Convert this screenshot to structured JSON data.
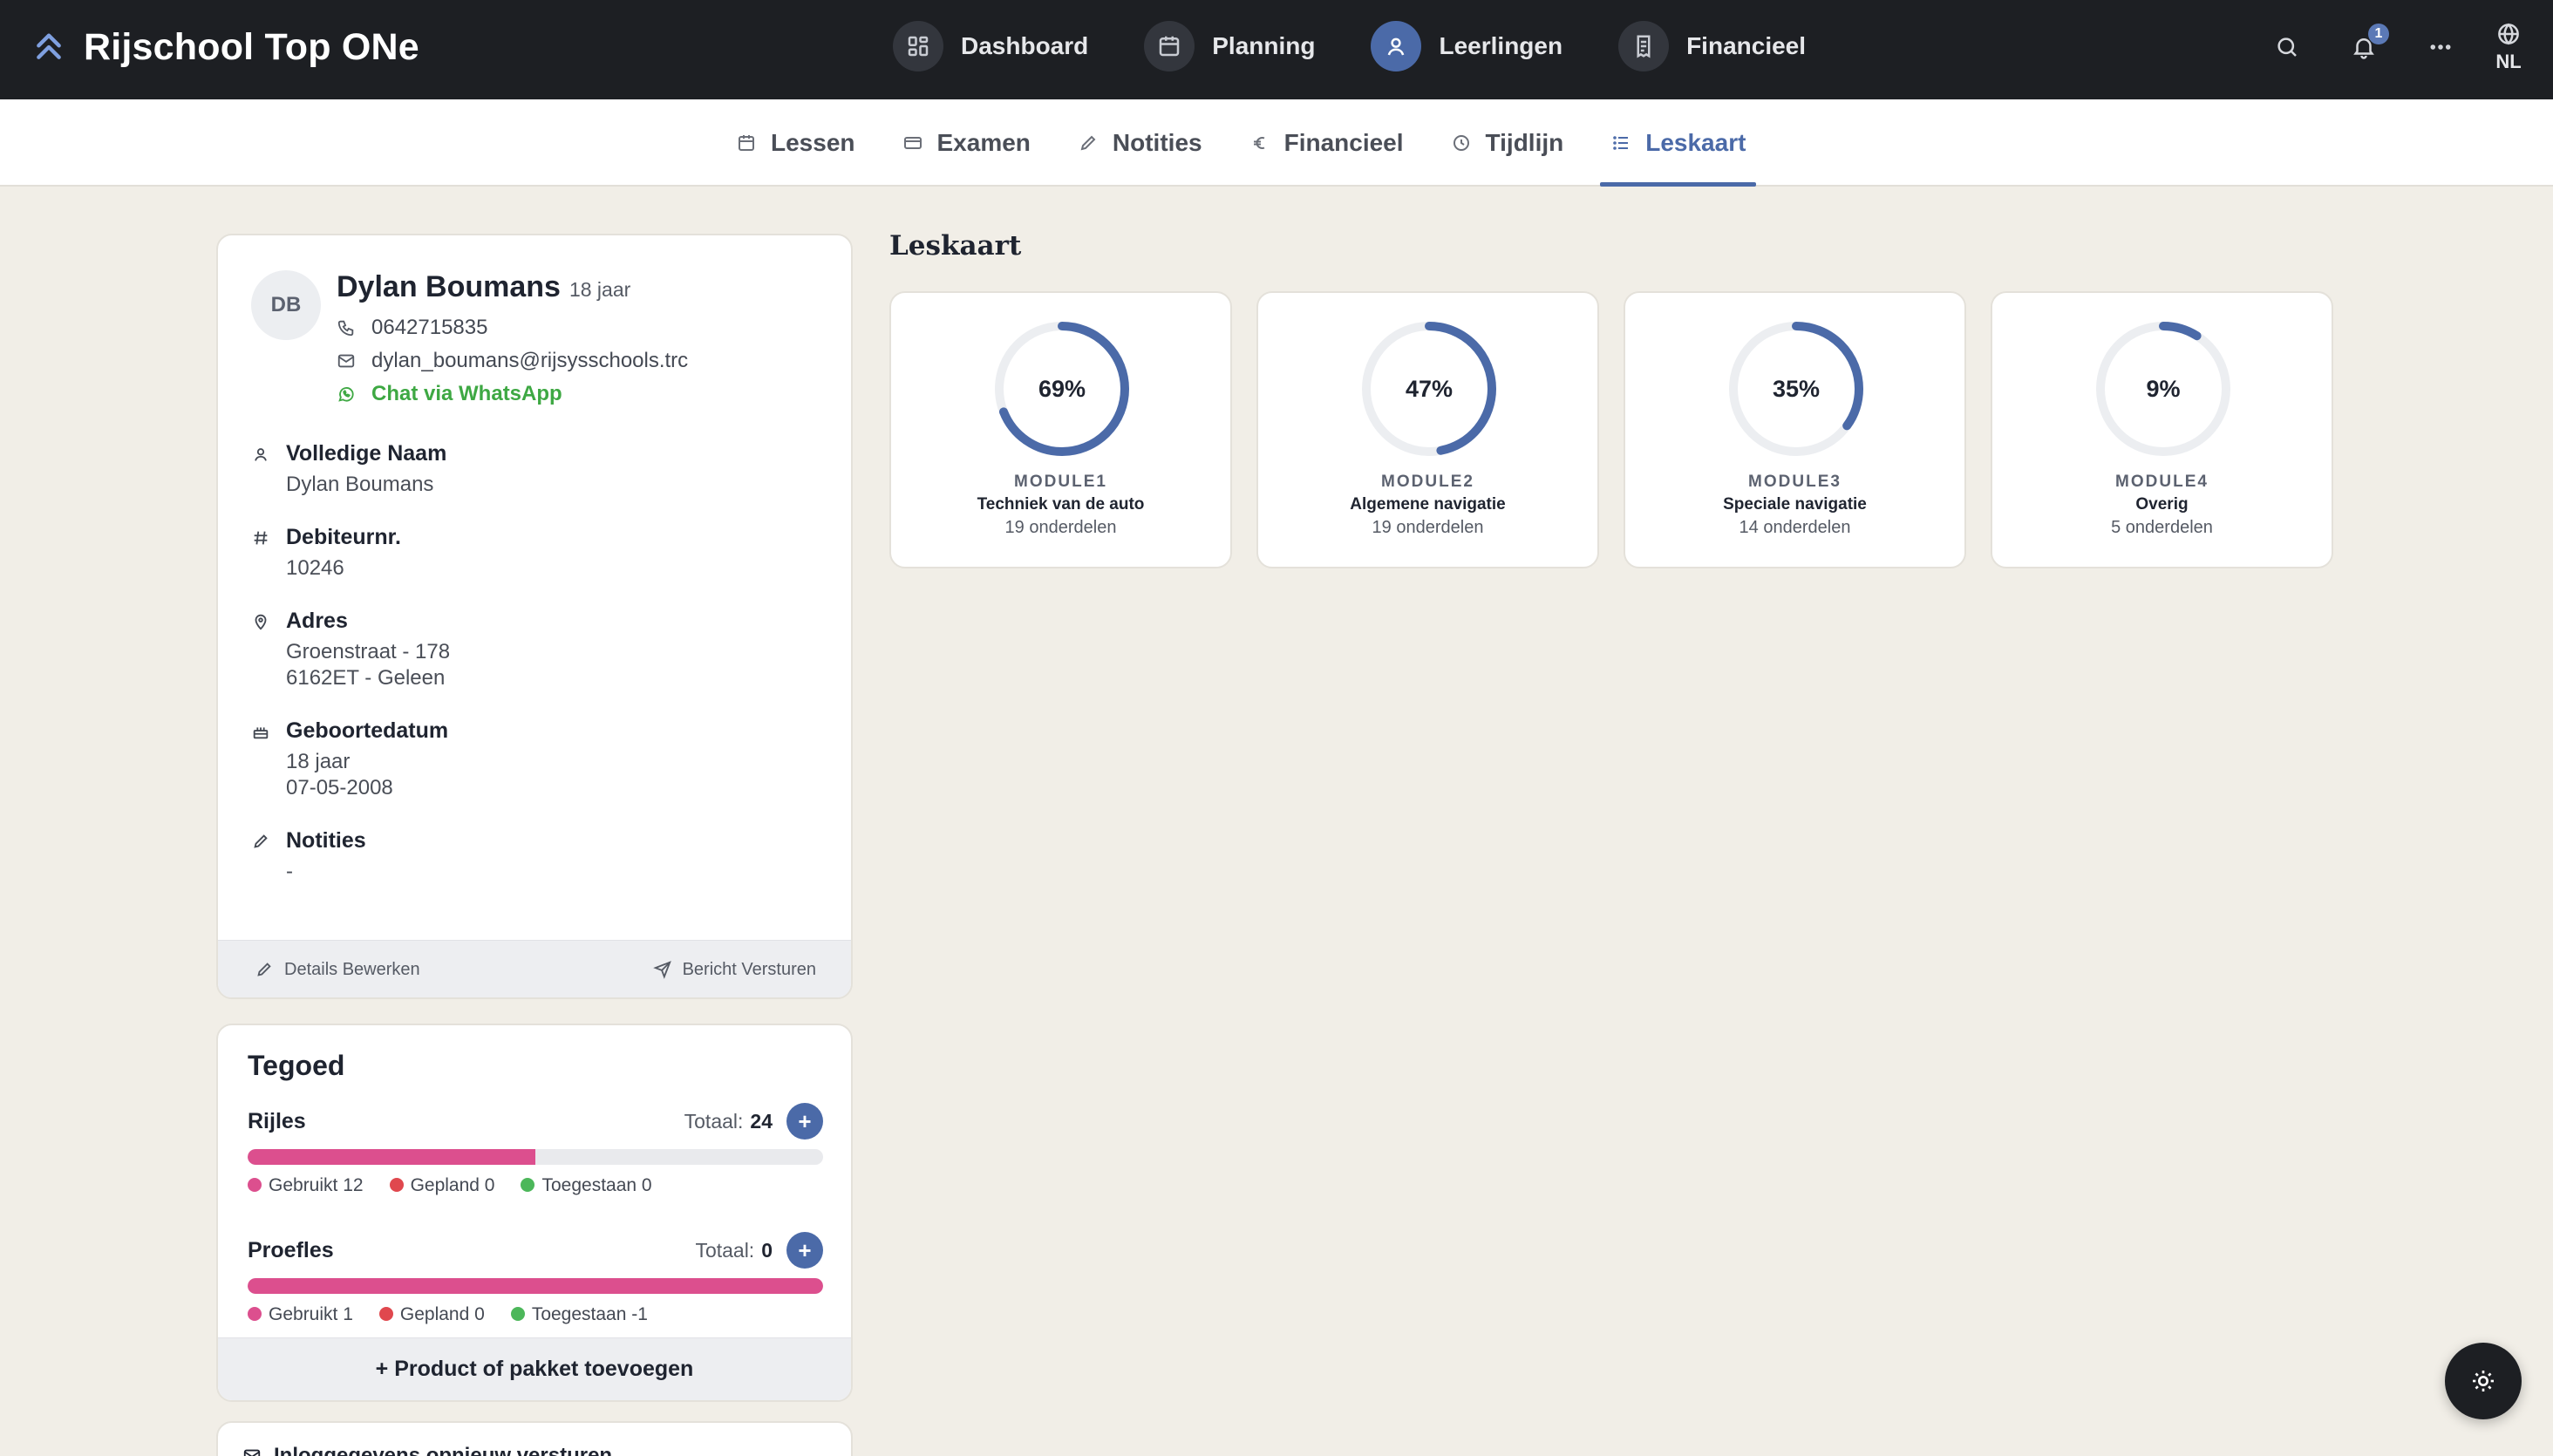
{
  "app": {
    "brand": "Rijschool Top ONe"
  },
  "nav": {
    "items": [
      {
        "label": "Dashboard",
        "icon": "grid-icon"
      },
      {
        "label": "Planning",
        "icon": "calendar-icon"
      },
      {
        "label": "Leerlingen",
        "icon": "user-icon",
        "active": true
      },
      {
        "label": "Financieel",
        "icon": "receipt-icon"
      }
    ],
    "notifications_count": "1",
    "language": "NL"
  },
  "tabs": [
    {
      "label": "Lessen",
      "icon": "calendar-icon"
    },
    {
      "label": "Examen",
      "icon": "card-icon"
    },
    {
      "label": "Notities",
      "icon": "pencil-icon"
    },
    {
      "label": "Financieel",
      "icon": "euro-icon"
    },
    {
      "label": "Tijdlijn",
      "icon": "clock-icon"
    },
    {
      "label": "Leskaart",
      "icon": "list-icon",
      "active": true
    }
  ],
  "student": {
    "initials": "DB",
    "name": "Dylan Boumans",
    "age": "18 jaar",
    "phone": "0642715835",
    "email": "dylan_boumans@rijsysschools.trc",
    "whatsapp": "Chat via WhatsApp",
    "fields": {
      "full_name_label": "Volledige Naam",
      "full_name": "Dylan Boumans",
      "debtor_label": "Debiteurnr.",
      "debtor": "10246",
      "address_label": "Adres",
      "address_line1": "Groenstraat - 178",
      "address_line2": "6162ET - Geleen",
      "birth_label": "Geboortedatum",
      "birth_age": "18 jaar",
      "birth_date": "07-05-2008",
      "notes_label": "Notities",
      "notes": "-"
    },
    "actions": {
      "edit": "Details Bewerken",
      "message": "Bericht Versturen"
    }
  },
  "tegoed": {
    "title": "Tegoed",
    "total_label": "Totaal:",
    "rows": [
      {
        "name": "Rijles",
        "total": "24",
        "used_fraction": 0.5,
        "used": "Gebruikt 12",
        "planned": "Gepland 0",
        "allowed": "Toegestaan 0"
      },
      {
        "name": "Proefles",
        "total": "0",
        "used_fraction": 1.0,
        "used": "Gebruikt 1",
        "planned": "Gepland 0",
        "allowed": "Toegestaan -1"
      }
    ],
    "add_product": "+ Product of pakket toevoegen",
    "resend_login": "Inloggegevens opnieuw versturen"
  },
  "leskaart": {
    "title": "Leskaart",
    "modules": [
      {
        "name": "MODULE1",
        "desc": "Techniek van de auto",
        "count": "19 onderdelen",
        "percent": 69,
        "label": "69%"
      },
      {
        "name": "MODULE2",
        "desc": "Algemene navigatie",
        "count": "19 onderdelen",
        "percent": 47,
        "label": "47%"
      },
      {
        "name": "MODULE3",
        "desc": "Speciale navigatie",
        "count": "14 onderdelen",
        "percent": 35,
        "label": "35%"
      },
      {
        "name": "MODULE4",
        "desc": "Overig",
        "count": "5 onderdelen",
        "percent": 9,
        "label": "9%"
      }
    ]
  },
  "colors": {
    "accent": "#4b6aa8",
    "used": "#dc4f8e",
    "planned": "#e0484e",
    "allowed": "#4cb75a",
    "whatsapp": "#3ea843"
  }
}
